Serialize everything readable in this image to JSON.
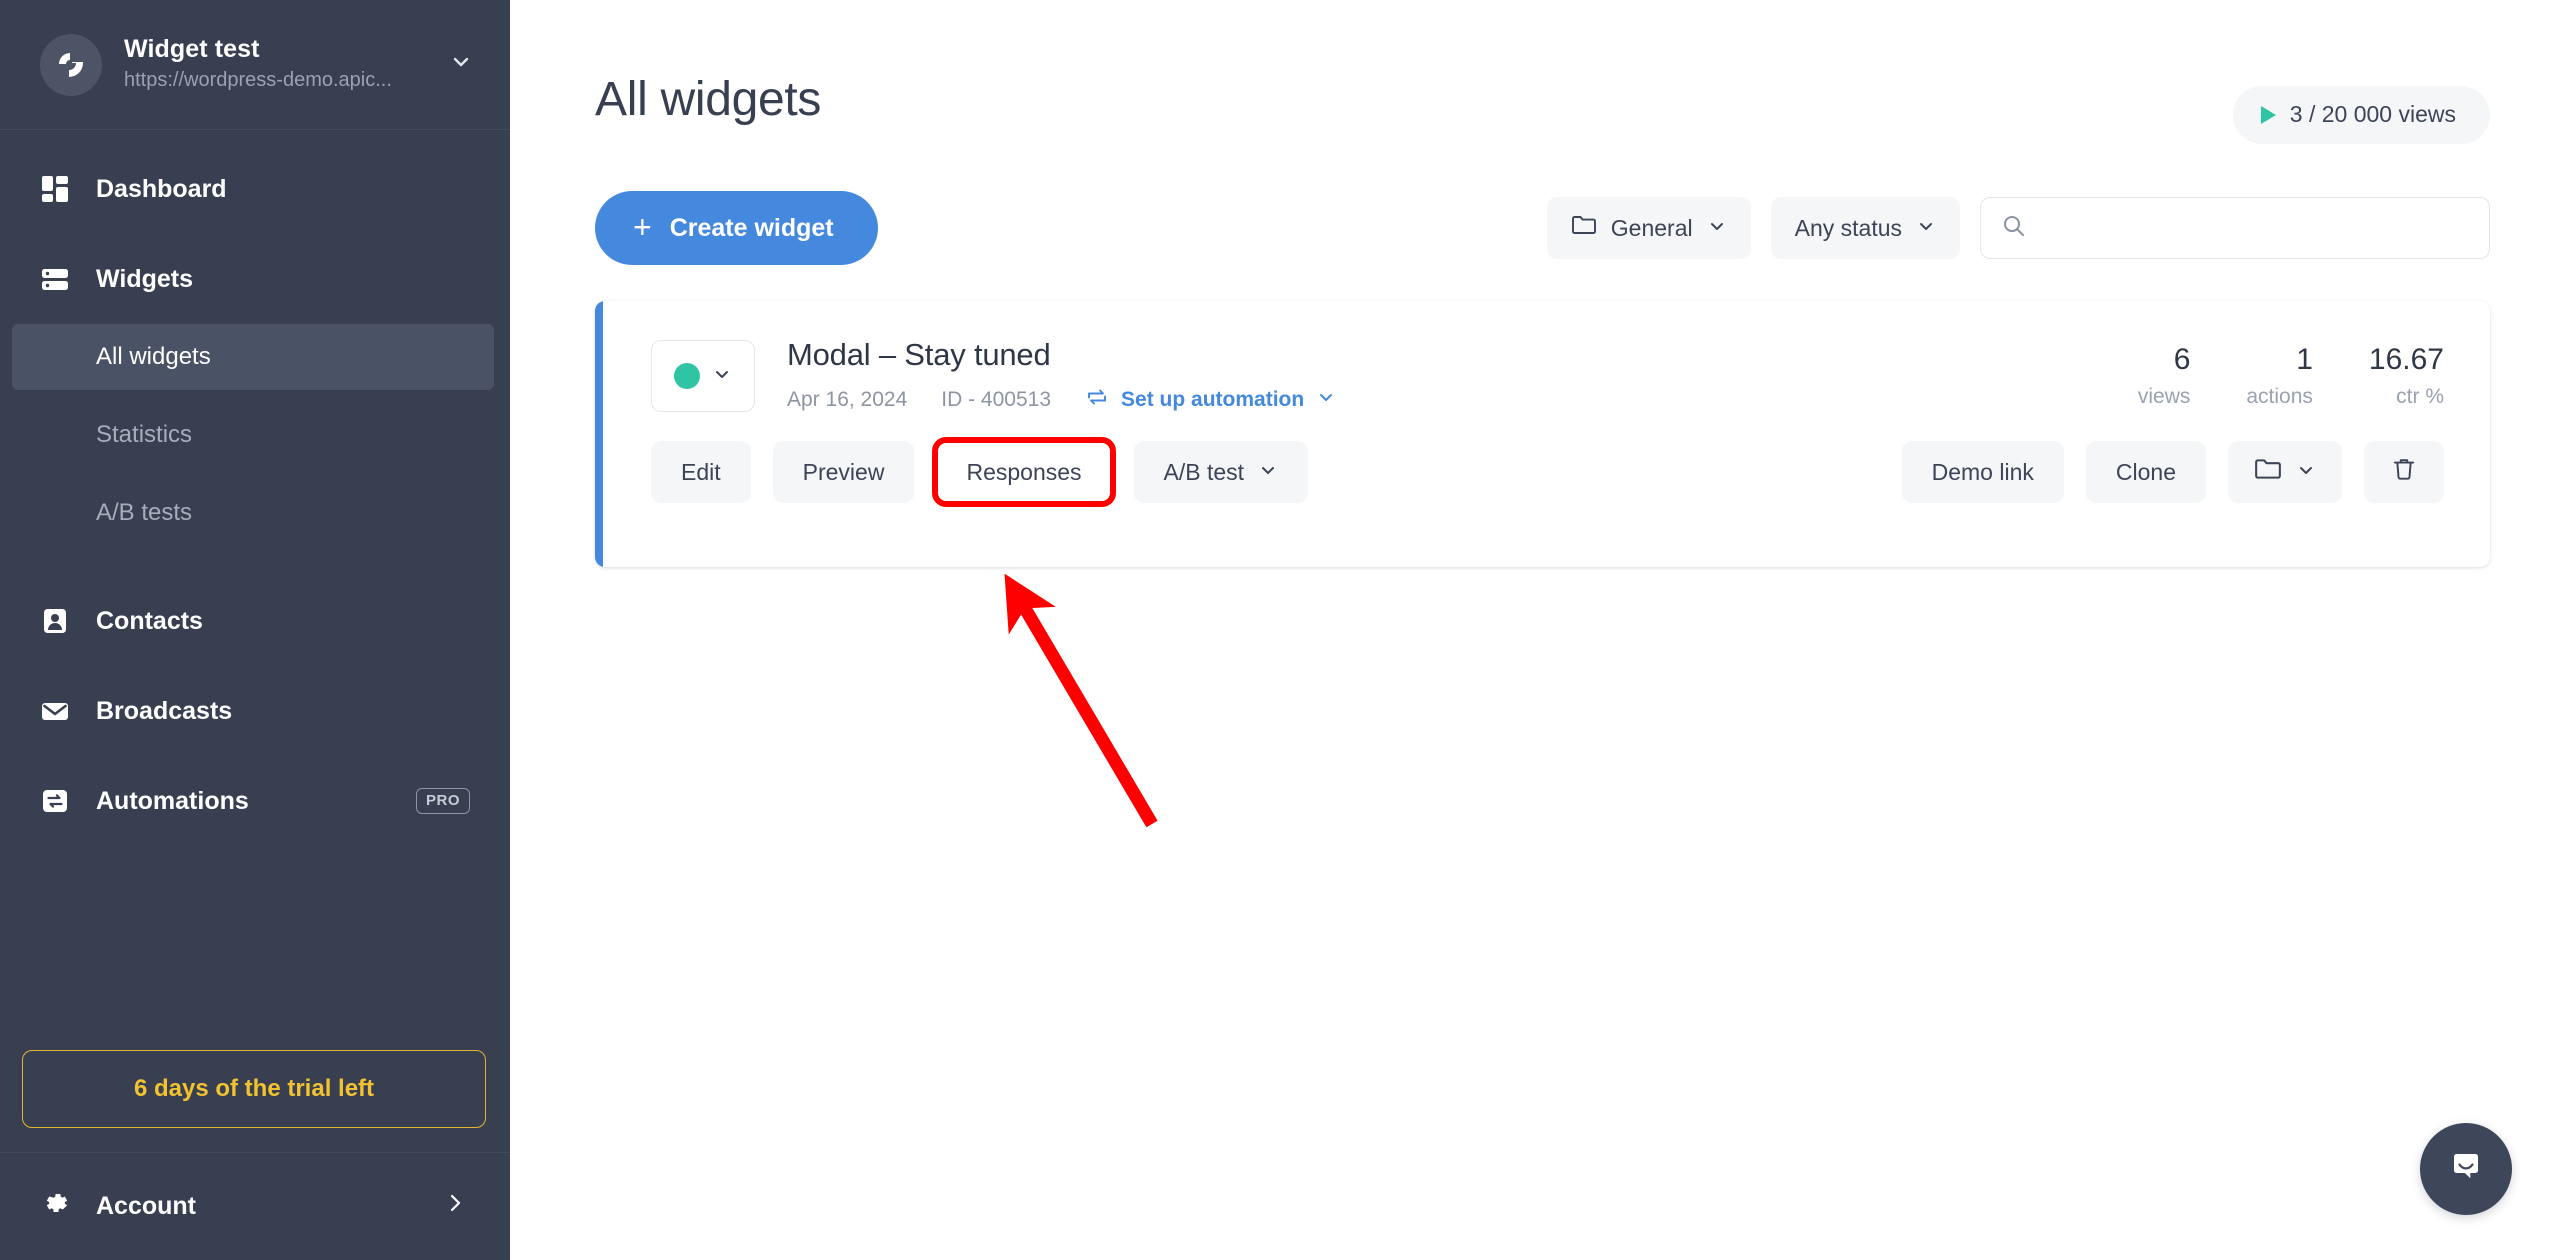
{
  "sidebar": {
    "brand": {
      "name": "Widget test",
      "url": "https://wordpress-demo.apic...",
      "logo_icon": "claspo-logo-icon",
      "caret_icon": "chevron-down-icon"
    },
    "nav": [
      {
        "label": "Dashboard",
        "icon": "dashboard-grid-icon"
      },
      {
        "label": "Widgets",
        "icon": "widgets-list-icon"
      }
    ],
    "sub_items": [
      {
        "label": "All widgets",
        "active": true
      },
      {
        "label": "Statistics",
        "active": false
      },
      {
        "label": "A/B tests",
        "active": false
      }
    ],
    "nav_lower": [
      {
        "label": "Contacts",
        "icon": "contact-person-icon",
        "badge": ""
      },
      {
        "label": "Broadcasts",
        "icon": "envelope-icon",
        "badge": ""
      },
      {
        "label": "Automations",
        "icon": "automation-loop-icon",
        "badge": "PRO"
      }
    ],
    "trial": {
      "label": "6 days of the trial left",
      "color": "#f2c230"
    },
    "account": {
      "label": "Account",
      "icon": "gear-icon",
      "chevron": "chevron-right-icon"
    }
  },
  "header": {
    "title": "All widgets",
    "views_badge": {
      "text": "3 / 20 000 views",
      "icon": "play-triangle-icon",
      "accent": "#2fc4a4"
    }
  },
  "toolbar": {
    "create_label": "Create widget",
    "create_icon": "plus-icon",
    "create_color": "#4489dd",
    "folder_filter": {
      "label": "General",
      "icon": "folder-icon",
      "caret": "chevron-down-icon"
    },
    "status_filter": {
      "label": "Any status",
      "caret": "chevron-down-icon"
    },
    "search": {
      "value": "",
      "placeholder": "",
      "icon": "search-icon"
    }
  },
  "widget_card": {
    "accent_color": "#4489dd",
    "status": {
      "dot_color": "#2fc4a4",
      "caret": "chevron-down-icon"
    },
    "name": "Modal – Stay tuned",
    "date": "Apr 16, 2024",
    "id": "ID - 400513",
    "automation": {
      "label": "Set up automation",
      "icon": "automation-loop-icon",
      "caret": "chevron-down-icon"
    },
    "stats": [
      {
        "value": "6",
        "label": "views"
      },
      {
        "value": "1",
        "label": "actions"
      },
      {
        "value": "16.67",
        "label": "ctr %"
      }
    ],
    "actions_left": [
      {
        "label": "Edit",
        "highlighted": false
      },
      {
        "label": "Preview",
        "highlighted": false
      },
      {
        "label": "Responses",
        "highlighted": true
      },
      {
        "label": "A/B test",
        "caret": "chevron-down-icon",
        "highlighted": false
      }
    ],
    "actions_right": [
      {
        "label": "Demo link",
        "icon": ""
      },
      {
        "label": "Clone",
        "icon": ""
      },
      {
        "label": "",
        "icon": "folder-icon",
        "caret": "chevron-down-icon"
      },
      {
        "label": "",
        "icon": "trash-icon"
      }
    ]
  },
  "annotation": {
    "color": "#ff0000",
    "arrow_from": "1150,825",
    "arrow_to": "1000,578"
  },
  "intercom": {
    "icon": "intercom-chat-icon",
    "color": "#3e4659"
  }
}
